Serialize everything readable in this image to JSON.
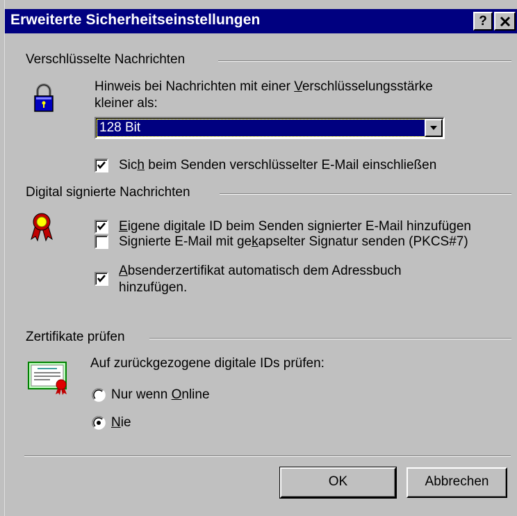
{
  "window": {
    "title": "Erweiterte Sicherheitseinstellungen",
    "help_label": "?",
    "close_label": "X"
  },
  "encrypted": {
    "group_label": "Verschlüsselte Nachrichten",
    "hint_line1_a": "Hinweis bei Nachrichten mit einer ",
    "hint_line1_u": "V",
    "hint_line1_b": "erschlüsselungsstärke",
    "hint_line2": "kleiner als:",
    "strength_selected": "128 Bit",
    "include_self": {
      "label_a": "Sic",
      "label_u": "h",
      "label_b": " beim Senden verschlüsselter E-Mail einschließen",
      "checked": true
    },
    "icon": "padlock-icon"
  },
  "signed": {
    "group_label": "Digital signierte Nachrichten",
    "icon": "award-ribbon-icon",
    "add_own_id": {
      "label_u": "E",
      "label_b": "igene digitale ID beim Senden signierter E-Mail hinzufügen",
      "checked": true
    },
    "opaque_signature": {
      "label_a": "Signierte E-Mail mit ge",
      "label_u": "k",
      "label_b": "apselter Signatur senden (PKCS#7)",
      "checked": false
    },
    "add_sender_cert": {
      "label_u": "A",
      "label_b": "bsenderzertifikat automatisch dem Adressbuch",
      "label_line2": "hinzufügen.",
      "checked": true
    }
  },
  "revocation": {
    "group_label": "Zertifikate prüfen",
    "icon": "certificate-icon",
    "prompt": "Auf zurückgezogene digitale IDs prüfen:",
    "options": [
      {
        "label_a": "Nur wenn ",
        "label_u": "O",
        "label_b": "nline",
        "selected": false
      },
      {
        "label_a": "",
        "label_u": "N",
        "label_b": "ie",
        "selected": true
      }
    ]
  },
  "buttons": {
    "ok_label": "OK",
    "cancel_label": "Abbrechen"
  },
  "colors": {
    "titlebar": "#000080",
    "face": "#c0c0c0",
    "selection": "#000080"
  }
}
